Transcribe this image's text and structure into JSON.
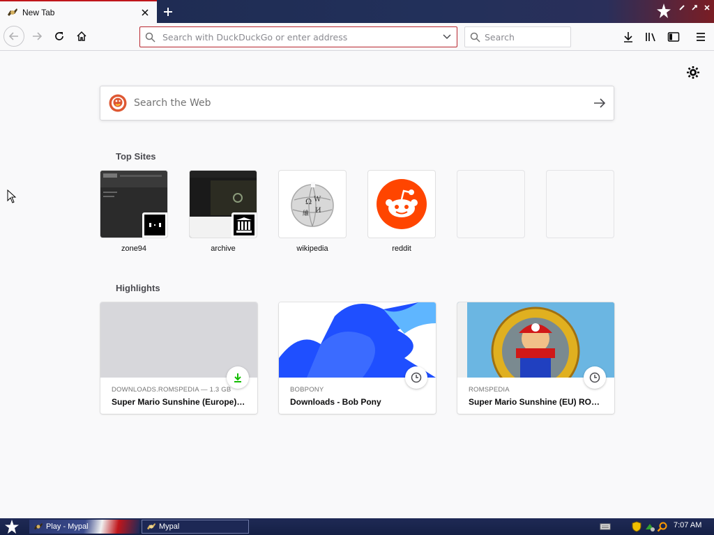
{
  "tab": {
    "title": "New Tab"
  },
  "urlbar": {
    "placeholder": "Search with DuckDuckGo or enter address"
  },
  "searchbar": {
    "placeholder": "Search"
  },
  "websearch": {
    "placeholder": "Search the Web"
  },
  "sections": {
    "top_sites": "Top Sites",
    "highlights": "Highlights"
  },
  "top_sites": [
    {
      "label": "zone94"
    },
    {
      "label": "archive"
    },
    {
      "label": "wikipedia"
    },
    {
      "label": "reddit"
    }
  ],
  "highlights": [
    {
      "source": "DOWNLOADS.ROMSPEDIA — 1.3 GB",
      "title": "Super Mario Sunshine (Europe) (...",
      "badge": "download-icon"
    },
    {
      "source": "BOBPONY",
      "title": "Downloads - Bob Pony",
      "badge": "clock-icon"
    },
    {
      "source": "ROMSPEDIA",
      "title": "Super Mario Sunshine (EU) ROM ...",
      "badge": "clock-icon"
    }
  ],
  "taskbar": {
    "task1": "Play - Mypal",
    "task2": "Mypal",
    "clock": "7:07 AM"
  },
  "colors": {
    "accent_red": "#b8262e",
    "reddit": "#ff4500",
    "ddg": "#de5833",
    "download_green": "#12bc00"
  }
}
